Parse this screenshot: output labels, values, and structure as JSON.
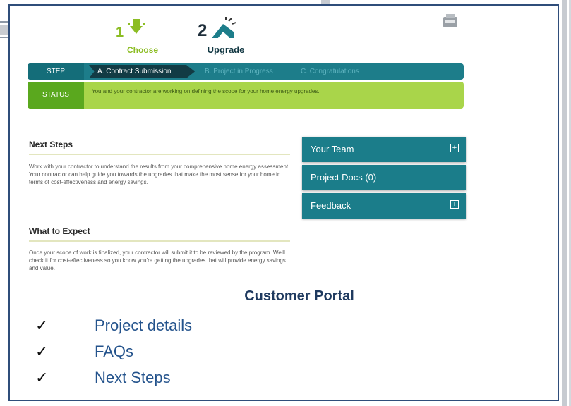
{
  "steps": {
    "choose": {
      "number": "1",
      "label": "Choose"
    },
    "upgrade": {
      "number": "2",
      "label": "Upgrade"
    }
  },
  "step_bar": {
    "tag": "STEP",
    "items": [
      {
        "label": "A. Contract Submission",
        "state": "active"
      },
      {
        "label": "B. Project in Progress",
        "state": "inactive"
      },
      {
        "label": "C. Congratulations",
        "state": "inactive"
      }
    ]
  },
  "status_bar": {
    "tag": "STATUS",
    "text": "You and your contractor are working on defining the scope for your home energy upgrades."
  },
  "next_steps": {
    "title": "Next Steps",
    "body": "Work with your contractor to understand the results from your comprehensive home energy assessment. Your contractor can help guide you towards the upgrades that make the most sense for your home in terms of cost-effectiveness and energy savings."
  },
  "what_to_expect": {
    "title": "What to Expect",
    "body": "Once your scope of work is finalized, your contractor will submit it to be reviewed by the program. We'll check it for cost-effectiveness so you know you're getting the upgrades that will provide energy savings and value."
  },
  "sidebar": {
    "items": [
      {
        "label": "Your Team",
        "icon": "plus-box-icon"
      },
      {
        "label": "Project Docs (0)"
      },
      {
        "label": "Feedback",
        "icon": "plus-box-icon"
      }
    ]
  },
  "overlay": {
    "title": "Customer Portal",
    "bullets": [
      "Project details",
      "FAQs",
      "Next Steps"
    ],
    "check_glyph": "✓"
  },
  "colors": {
    "teal": "#1d7d8a",
    "lime": "#a9d54a",
    "green": "#8cbd24",
    "navy_text": "#24538c",
    "frame_border": "#2f4d7a"
  }
}
